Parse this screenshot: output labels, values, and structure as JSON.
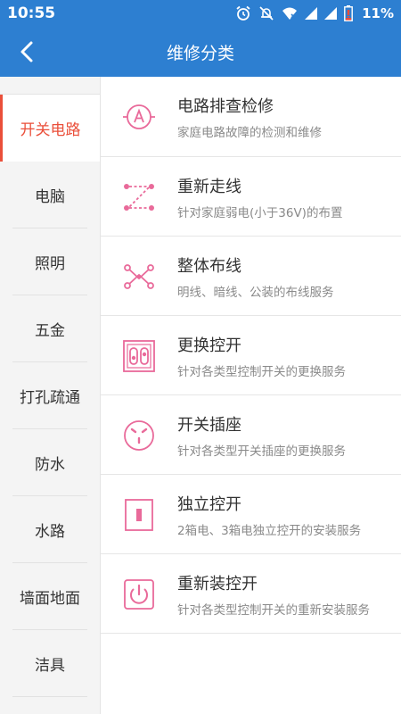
{
  "status_bar": {
    "time": "10:55",
    "battery_percent": "11%",
    "icons": [
      "alarm-icon",
      "mute-icon",
      "wifi-icon",
      "signal-icon",
      "signal-icon",
      "battery-icon"
    ]
  },
  "app_bar": {
    "title": "维修分类",
    "back_icon": "chevron-left-icon"
  },
  "colors": {
    "primary": "#2d7fd1",
    "accent": "#ea4f3a",
    "icon_pink": "#e96a9a"
  },
  "sidebar": {
    "items": [
      {
        "label": "开关电路",
        "active": true
      },
      {
        "label": "电脑",
        "active": false
      },
      {
        "label": "照明",
        "active": false
      },
      {
        "label": "五金",
        "active": false
      },
      {
        "label": "打孔疏通",
        "active": false
      },
      {
        "label": "防水",
        "active": false
      },
      {
        "label": "水路",
        "active": false
      },
      {
        "label": "墙面地面",
        "active": false
      },
      {
        "label": "洁具",
        "active": false
      }
    ]
  },
  "services": [
    {
      "name": "电路排查检修",
      "desc": "家庭电路故障的检测和维修",
      "icon": "ammeter-icon"
    },
    {
      "name": "重新走线",
      "desc": "针对家庭弱电(小于36V)的布置",
      "icon": "rewire-icon"
    },
    {
      "name": "整体布线",
      "desc": "明线、暗线、公装的布线服务",
      "icon": "network-wiring-icon"
    },
    {
      "name": "更换控开",
      "desc": "针对各类型控制开关的更换服务",
      "icon": "switch-panel-icon"
    },
    {
      "name": "开关插座",
      "desc": "针对各类型开关插座的更换服务",
      "icon": "socket-icon"
    },
    {
      "name": "独立控开",
      "desc": "2箱电、3箱电独立控开的安装服务",
      "icon": "single-switch-icon"
    },
    {
      "name": "重新装控开",
      "desc": "针对各类型控制开关的重新安装服务",
      "icon": "power-switch-icon"
    }
  ]
}
